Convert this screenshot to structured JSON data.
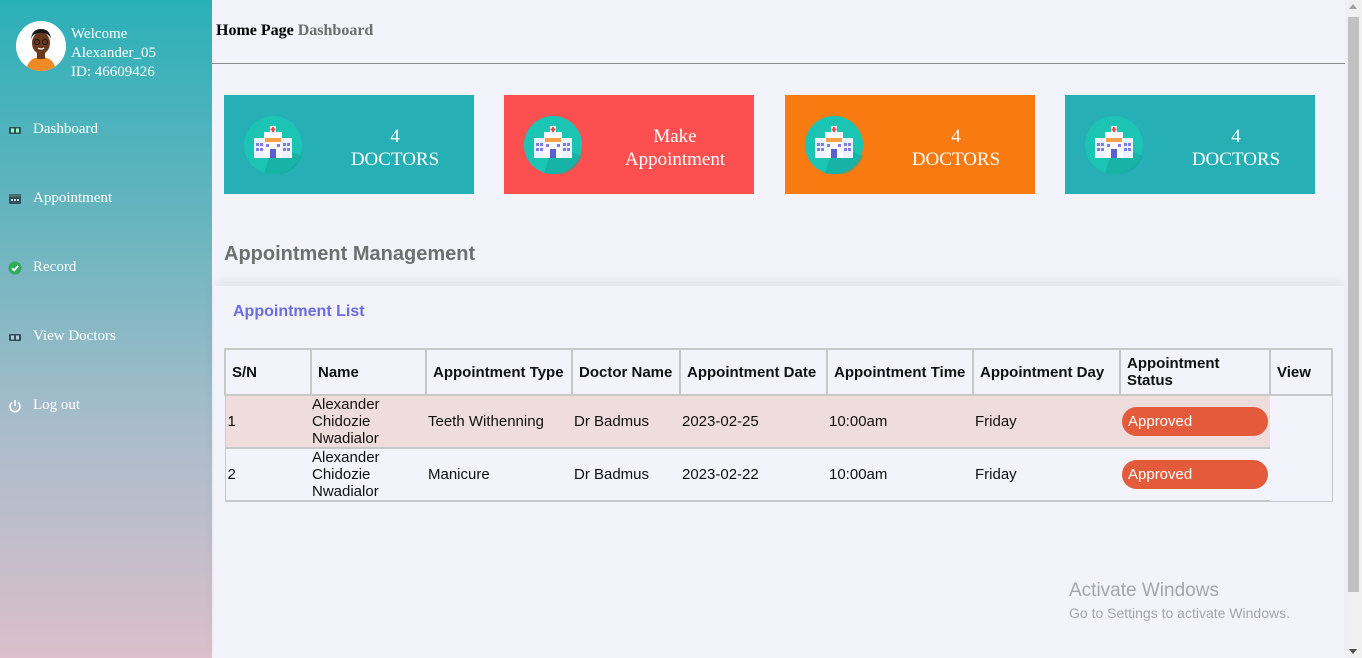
{
  "sidebar": {
    "welcome": "Welcome",
    "username": "Alexander_05",
    "id_text": "ID: 46609426",
    "items": [
      {
        "label": "Dashboard",
        "icon": "dashboard-icon"
      },
      {
        "label": "Appointment",
        "icon": "appointment-icon"
      },
      {
        "label": "Record",
        "icon": "check-circle-icon"
      },
      {
        "label": "View Doctors",
        "icon": "doctors-icon"
      },
      {
        "label": "Log out",
        "icon": "power-icon"
      }
    ]
  },
  "header": {
    "crumb_home": "Home Page",
    "crumb_current": "Dashboard"
  },
  "cards": [
    {
      "line1": "4",
      "line2": "DOCTORS",
      "color": "#26b0b6"
    },
    {
      "line1": "Make",
      "line2": "Appointment",
      "color": "#fc5050"
    },
    {
      "line1": "4",
      "line2": "DOCTORS",
      "color": "#f97a10"
    },
    {
      "line1": "4",
      "line2": "DOCTORS",
      "color": "#26b0b6"
    }
  ],
  "section_title": "Appointment Management",
  "list_title": "Appointment List",
  "table": {
    "headers": [
      "S/N",
      "Name",
      "Appointment Type",
      "Doctor Name",
      "Appointment Date",
      "Appointment Time",
      "Appointment Day",
      "Appointment Status",
      "View"
    ],
    "rows": [
      {
        "sn": "1",
        "name": "Alexander Chidozie Nwadialor",
        "type": "Teeth Withenning",
        "doctor": "Dr Badmus",
        "date": "2023-02-25",
        "time": "10:00am",
        "day": "Friday",
        "status": "Approved"
      },
      {
        "sn": "2",
        "name": "Alexander Chidozie Nwadialor",
        "type": "Manicure",
        "doctor": "Dr Badmus",
        "date": "2023-02-22",
        "time": "10:00am",
        "day": "Friday",
        "status": "Approved"
      }
    ]
  },
  "watermark": {
    "line1": "Activate Windows",
    "line2": "Go to Settings to activate Windows."
  },
  "colors": {
    "accent_teal": "#26b0b6",
    "badge": "#e45b3c",
    "link_purple": "#6c6ce0"
  }
}
